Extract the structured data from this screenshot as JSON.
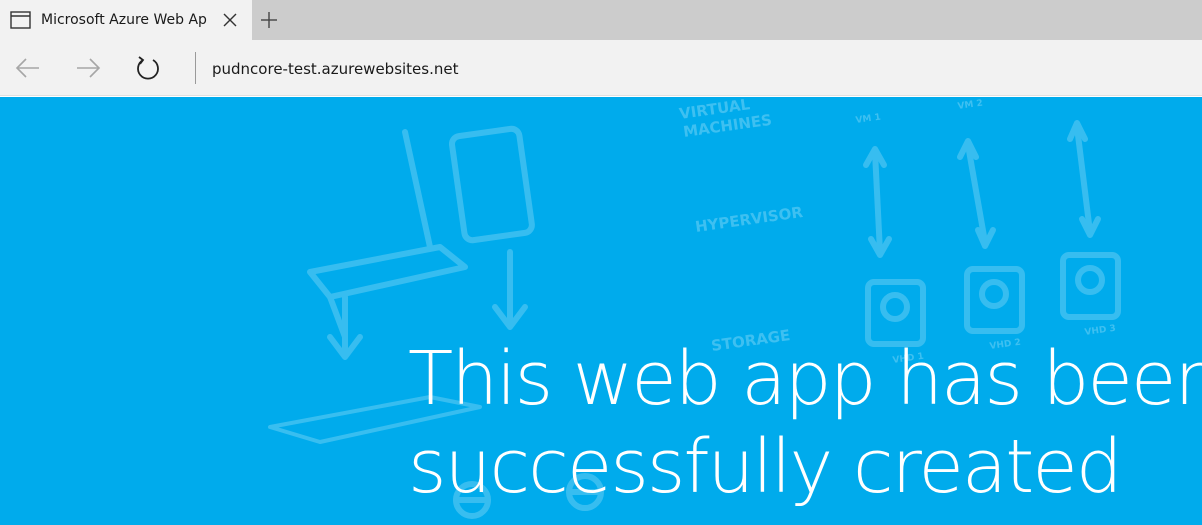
{
  "browser": {
    "tab": {
      "title": "Microsoft Azure Web Ap",
      "icon": "tab-page-icon"
    },
    "new_tab_icon": "plus-icon",
    "nav": {
      "back_icon": "arrow-left-icon",
      "forward_icon": "arrow-right-icon",
      "refresh_icon": "refresh-icon"
    },
    "address": "pudncore-test.azurewebsites.net"
  },
  "page": {
    "background_color": "#00abec",
    "illustration_labels": {
      "virtual_machines_line1": "VIRTUAL",
      "virtual_machines_line2": "MACHINES",
      "hypervisor": "HYPERVISOR",
      "storage": "STORAGE",
      "vm1": "VM 1",
      "vm2": "VM 2",
      "vhd1": "VHD 1",
      "vhd2": "VHD 2",
      "vhd3": "VHD 3"
    },
    "headline": {
      "line1": "This web app has been",
      "line2": "successfully created"
    }
  }
}
